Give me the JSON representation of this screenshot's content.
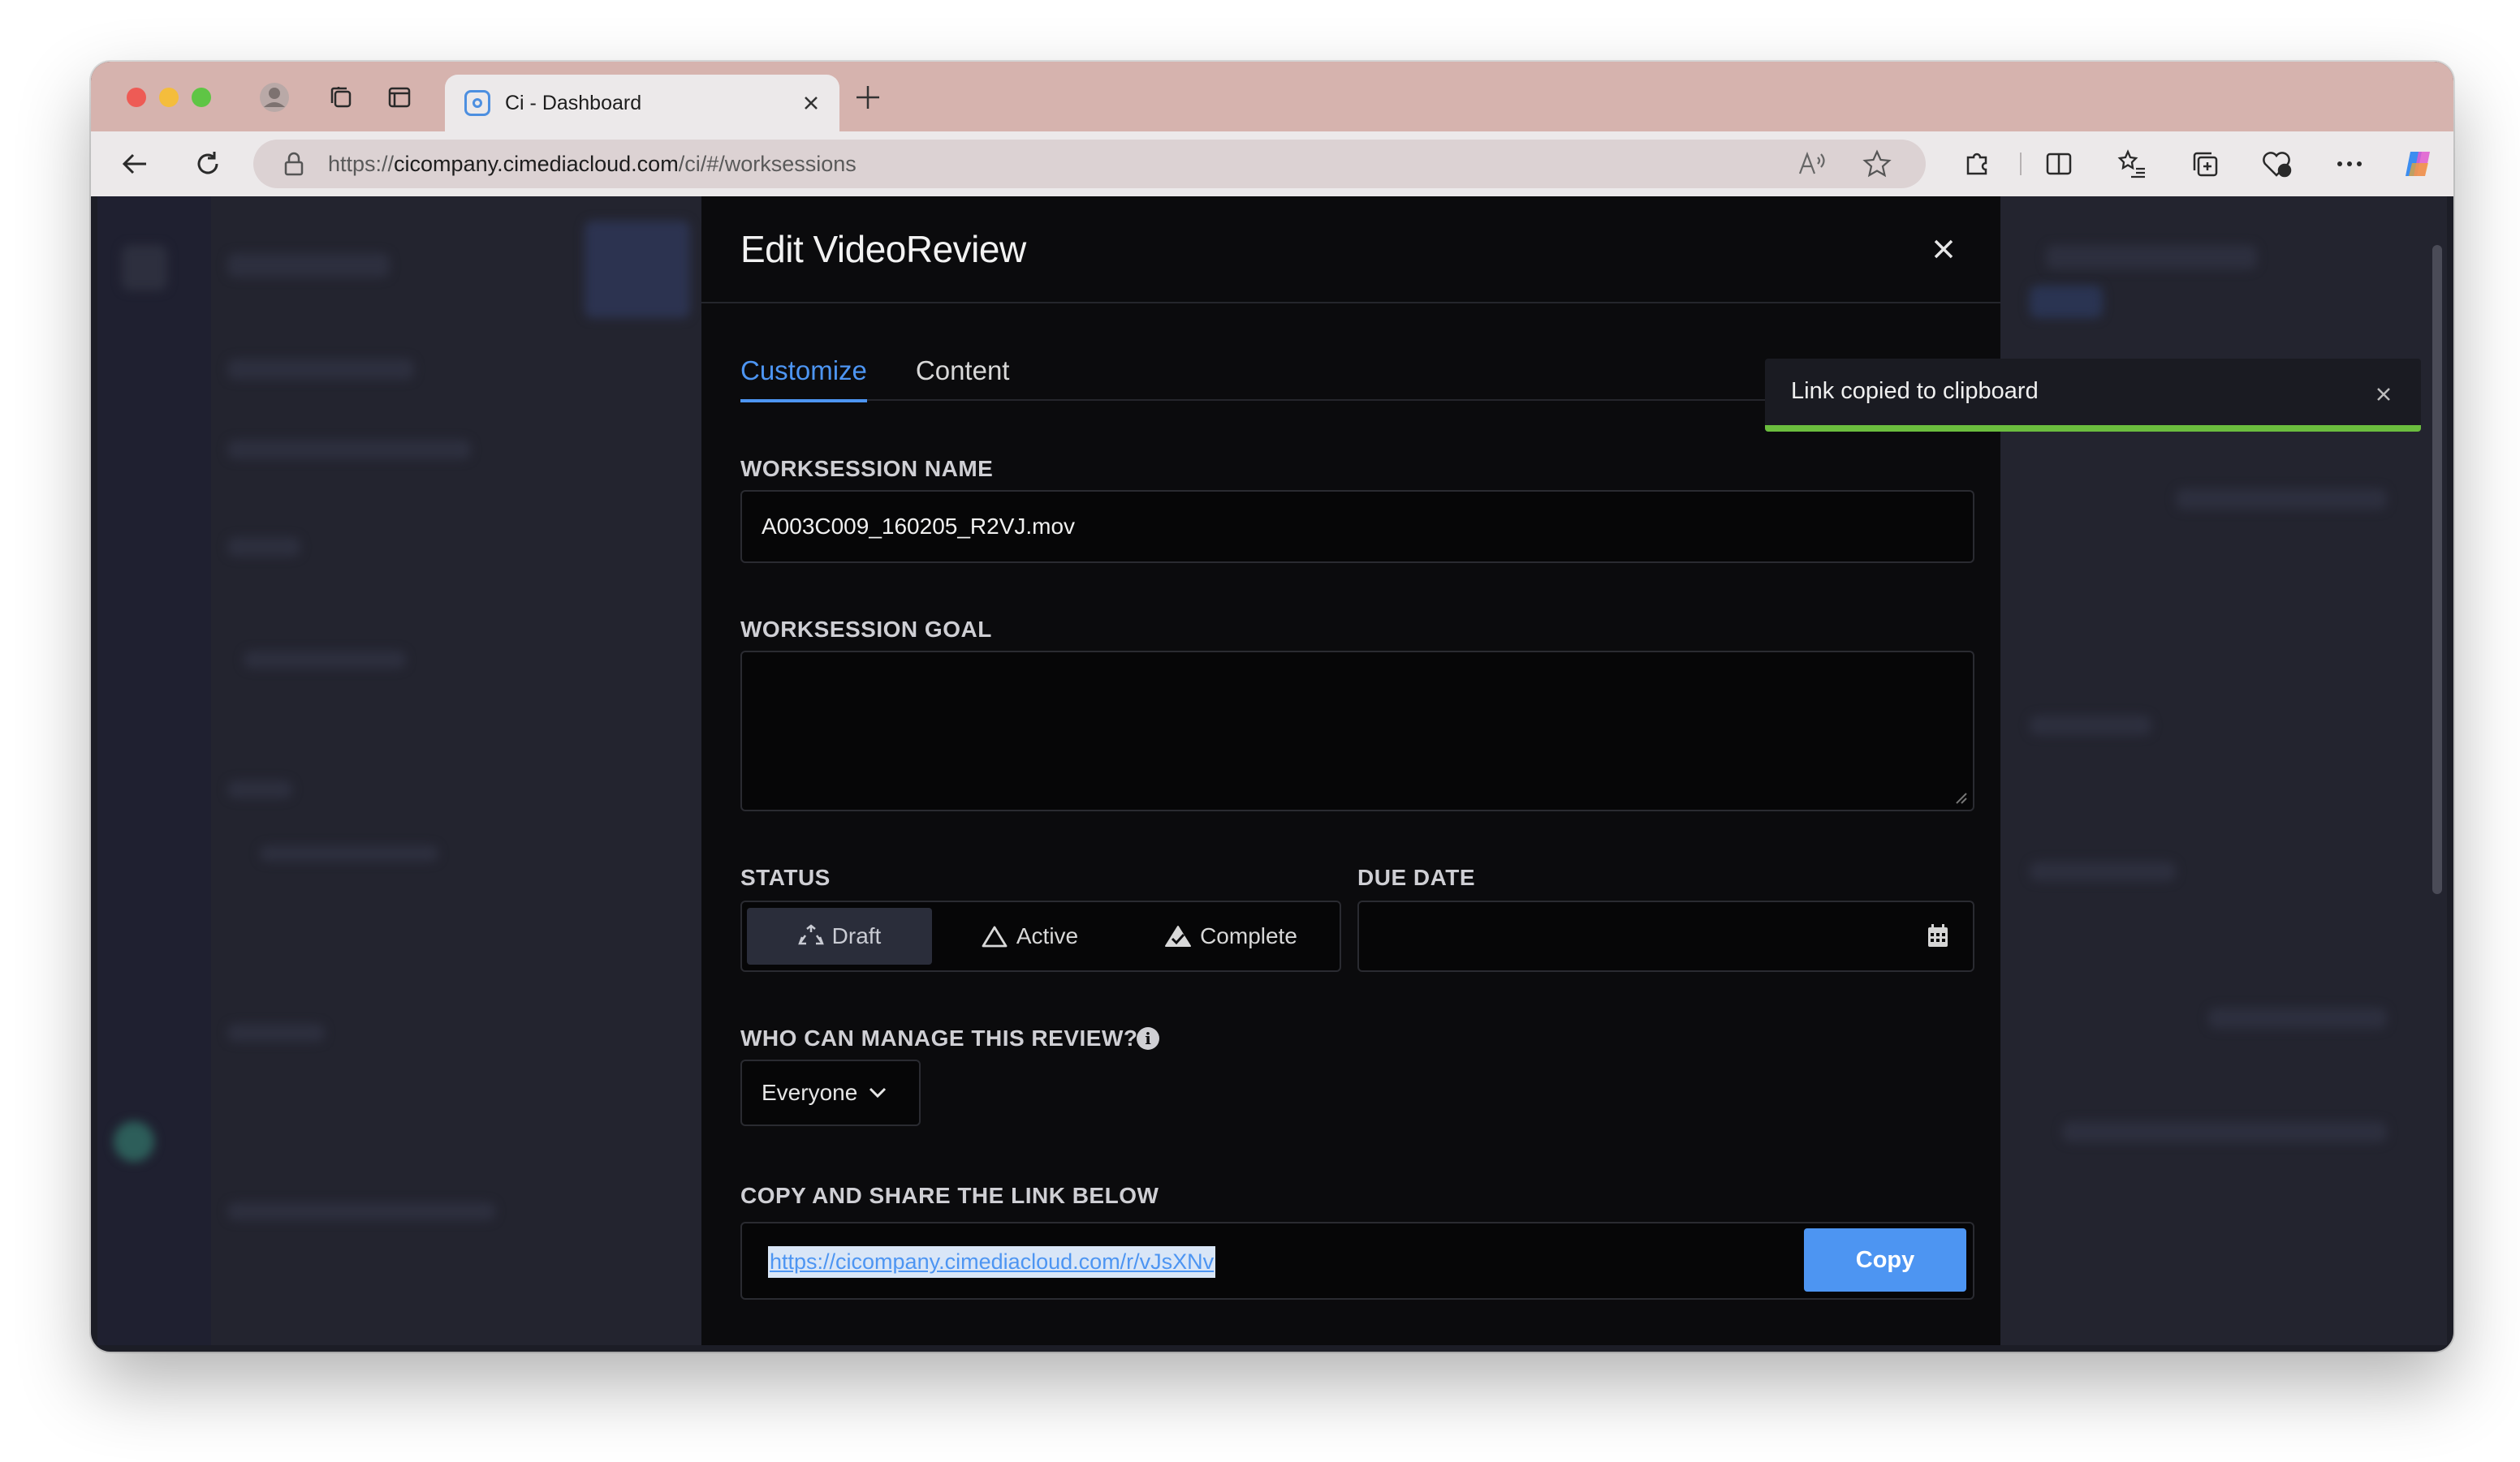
{
  "browser": {
    "tab_title": "Ci - Dashboard",
    "url_prefix": "https://",
    "url_host": "cicompany.cimediacloud.com",
    "url_path": "/ci/#/worksessions"
  },
  "modal": {
    "title": "Edit VideoReview",
    "tabs": [
      {
        "label": "Customize",
        "active": true
      },
      {
        "label": "Content",
        "active": false
      }
    ],
    "name_label": "WORKSESSION NAME",
    "name_value": "A003C009_160205_R2VJ.mov",
    "goal_label": "WORKSESSION GOAL",
    "goal_value": "",
    "status_label": "STATUS",
    "status_options": [
      {
        "label": "Draft",
        "icon": "recycle-icon",
        "active": true
      },
      {
        "label": "Active",
        "icon": "triangle-icon",
        "active": false
      },
      {
        "label": "Complete",
        "icon": "check-shape-icon",
        "active": false
      }
    ],
    "due_label": "DUE DATE",
    "due_value": "",
    "manage_label": "WHO CAN MANAGE THIS REVIEW?",
    "manage_value": "Everyone",
    "share_label": "COPY AND SHARE THE LINK BELOW",
    "share_link": "https://cicompany.cimediacloud.com/r/vJsXNv",
    "copy_label": "Copy"
  },
  "toast": {
    "message": "Link copied to clipboard",
    "accent": "#6bbd3e"
  },
  "colors": {
    "accent": "#4d95f2",
    "modal_bg": "#0b0b0d",
    "titlebar": "#d6b3ae"
  }
}
